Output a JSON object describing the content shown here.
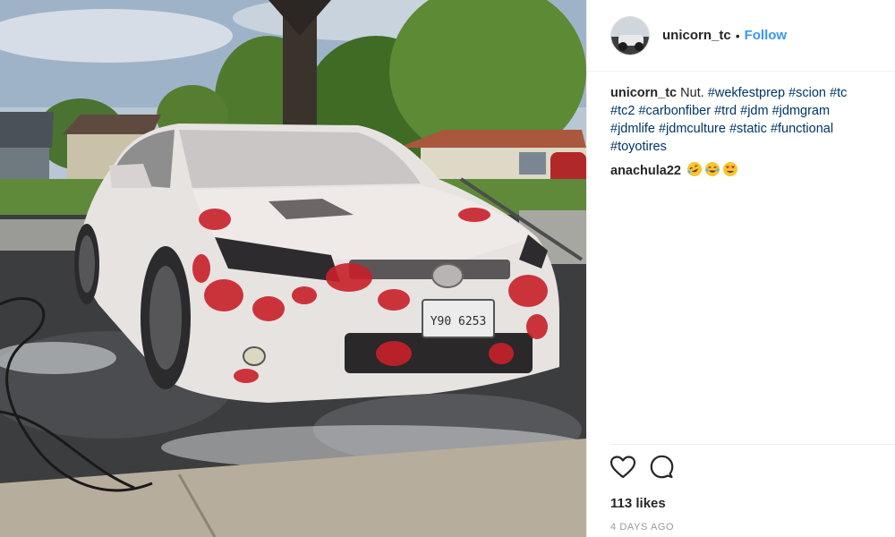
{
  "post": {
    "author": "unicorn_tc",
    "separator": "•",
    "follow_label": "Follow"
  },
  "caption": {
    "user": "unicorn_tc",
    "text": "Nut.",
    "hashtags": [
      "#wekfestprep",
      "#scion",
      "#tc",
      "#tc2",
      "#carbonfiber",
      "#trd",
      "#jdm",
      "#jdmgram",
      "#jdmlife",
      "#jdmculture",
      "#static",
      "#functional",
      "#toyotires"
    ]
  },
  "comment": {
    "user": "anachula22",
    "emojis": [
      "rolling-laughing-emoji",
      "tears-of-joy-emoji",
      "heart-eyes-emoji"
    ]
  },
  "footer": {
    "likes": "113 likes",
    "timestamp": "4 DAYS AGO"
  },
  "photo": {
    "plate_text": "Y90 6253"
  },
  "colors": {
    "link_blue": "#3897f0",
    "hashtag_navy": "#003569",
    "foam_red": "#c8202a"
  }
}
